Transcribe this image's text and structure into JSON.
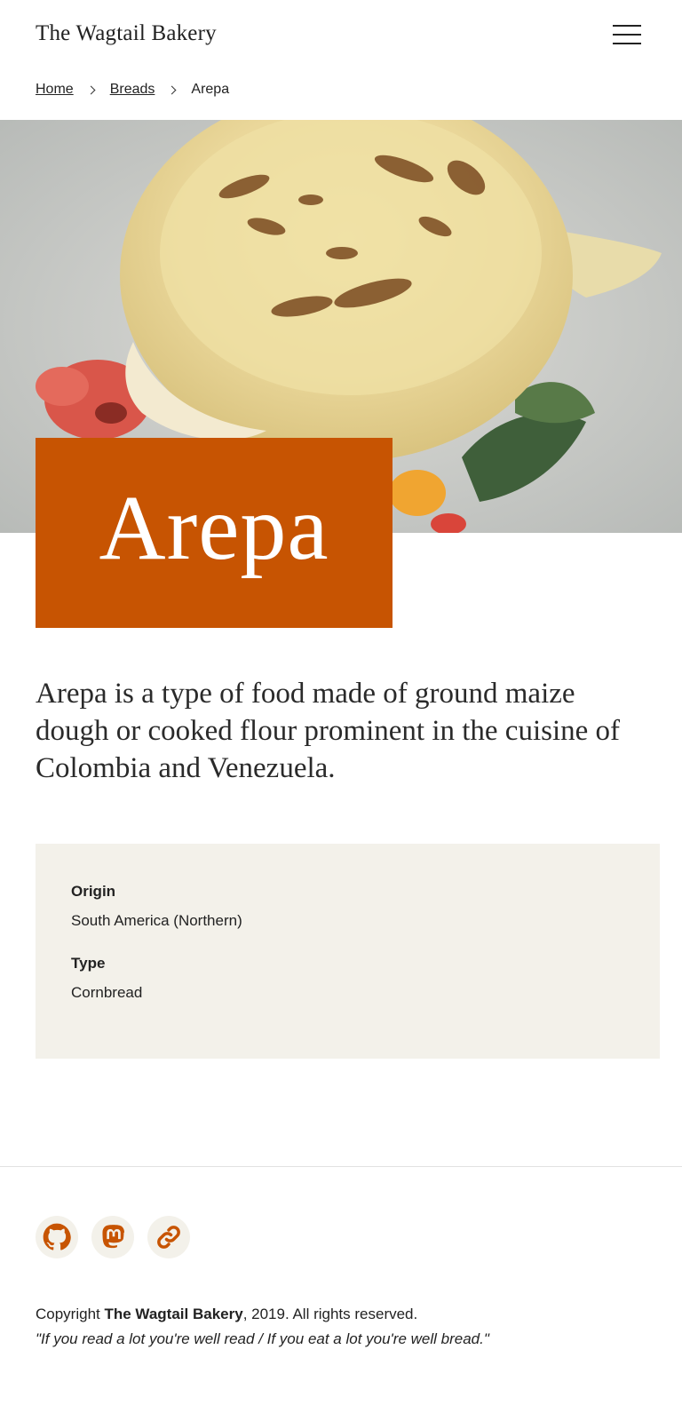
{
  "header": {
    "site_title": "The Wagtail Bakery",
    "menu_icon": "hamburger-menu-icon"
  },
  "breadcrumb": {
    "items": [
      {
        "label": "Home"
      },
      {
        "label": "Breads"
      },
      {
        "label": "Arepa"
      }
    ],
    "separator_icon": "chevron-right-icon"
  },
  "hero": {
    "image": "photo of an arepa on a plate"
  },
  "page": {
    "title": "Arepa",
    "intro": "Arepa is a type of food made of ground maize dough or cooked flour prominent in the cuisine of Colombia and Venezuela."
  },
  "details": {
    "origin_label": "Origin",
    "origin_value": "South America (Northern)",
    "type_label": "Type",
    "type_value": "Cornbread"
  },
  "footer": {
    "social_icons": [
      "github-icon",
      "mastodon-icon",
      "link-icon"
    ],
    "copyright_prefix": "Copyright ",
    "copyright_name": "The Wagtail Bakery",
    "copyright_suffix": ", 2019. All rights reserved.",
    "quote": "\"If you read a lot you're well read / If you eat a lot you're well bread.\""
  },
  "colors": {
    "accent": "#c75402",
    "panel_background": "#f3f1ea",
    "text": "#2a2a2a"
  }
}
